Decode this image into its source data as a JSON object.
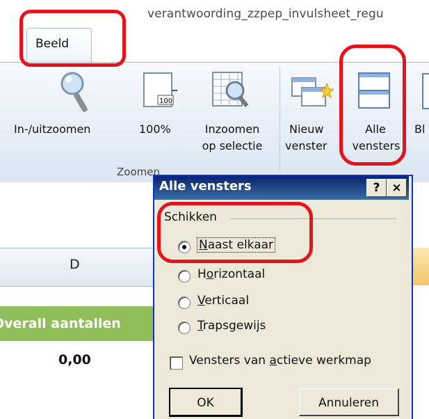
{
  "window": {
    "doc_title": "verantwoording_zzpep_invulsheet_regu"
  },
  "tabs": {
    "active": "Beeld"
  },
  "ribbon": {
    "zoom_group": {
      "label": "Zoomen",
      "items": [
        {
          "line1": "In-/uitzoomen",
          "line2": "",
          "icon": "magnifier-icon"
        },
        {
          "line1": "100%",
          "line2": "",
          "icon": "page-100-icon"
        },
        {
          "line1": "Inzoomen",
          "line2": "op selectie",
          "icon": "zoom-selection-icon"
        }
      ]
    },
    "window_group": {
      "items": [
        {
          "line1": "Nieuw",
          "line2": "venster",
          "icon": "new-window-icon"
        },
        {
          "line1": "Alle",
          "line2": "vensters",
          "icon": "arrange-all-icon"
        },
        {
          "line1": "Bl",
          "line2": "",
          "icon": "freeze-icon"
        }
      ]
    }
  },
  "sheet": {
    "column_label": "D",
    "header_cell": "Overall aantallen",
    "value": "0,00",
    "green": "#8fbd57"
  },
  "dialog": {
    "title": "Alle vensters",
    "help_btn": "?",
    "close_btn": "×",
    "fieldset_label": "Schikken",
    "options": [
      {
        "pre": "",
        "u": "N",
        "post": "aast elkaar",
        "checked": true
      },
      {
        "pre": "H",
        "u": "o",
        "post": "rizontaal",
        "checked": false
      },
      {
        "pre": "",
        "u": "V",
        "post": "erticaal",
        "checked": false
      },
      {
        "pre": "",
        "u": "T",
        "post": "rapsgewijs",
        "checked": false
      }
    ],
    "checkbox": {
      "pre": "Vensters van ",
      "u": "a",
      "post": "ctieve werkmap",
      "checked": false
    },
    "ok": "OK",
    "cancel": "Annuleren"
  },
  "colors": {
    "highlight": "#e3141b",
    "titlebar": "#0a246a"
  }
}
